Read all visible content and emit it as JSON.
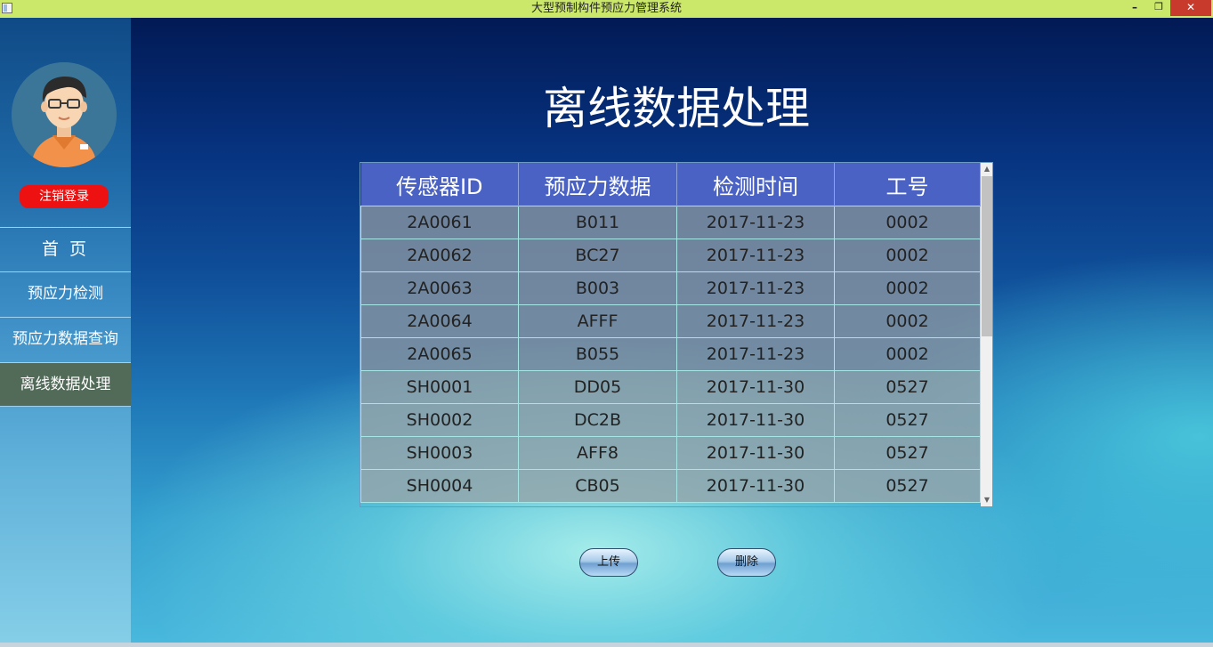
{
  "window": {
    "title": "大型预制构件预应力管理系统",
    "minimize_label": "–",
    "maximize_label": "❐",
    "close_label": "✕"
  },
  "sidebar": {
    "logout_label": "注销登录",
    "items": [
      {
        "label": "首 页"
      },
      {
        "label": "预应力检测"
      },
      {
        "label": "预应力数据查询"
      },
      {
        "label": "离线数据处理"
      }
    ],
    "active_index": 3
  },
  "main": {
    "title": "离线数据处理",
    "table": {
      "columns": [
        "传感器ID",
        "预应力数据",
        "检测时间",
        "工号"
      ],
      "rows": [
        [
          "2A0061",
          "B011",
          "2017-11-23",
          "0002"
        ],
        [
          "2A0062",
          "BC27",
          "2017-11-23",
          "0002"
        ],
        [
          "2A0063",
          "B003",
          "2017-11-23",
          "0002"
        ],
        [
          "2A0064",
          "AFFF",
          "2017-11-23",
          "0002"
        ],
        [
          "2A0065",
          "B055",
          "2017-11-23",
          "0002"
        ],
        [
          "SH0001",
          "DD05",
          "2017-11-30",
          "0527"
        ],
        [
          "SH0002",
          "DC2B",
          "2017-11-30",
          "0527"
        ],
        [
          "SH0003",
          "AFF8",
          "2017-11-30",
          "0527"
        ],
        [
          "SH0004",
          "CB05",
          "2017-11-30",
          "0527"
        ]
      ]
    },
    "upload_label": "上传",
    "delete_label": "删除"
  },
  "colors": {
    "titlebar": "#cbe86a",
    "header_row": "#4a62c4",
    "active_nav": "#526a58",
    "logout": "#ee1111",
    "close_button": "#c73a2c"
  }
}
